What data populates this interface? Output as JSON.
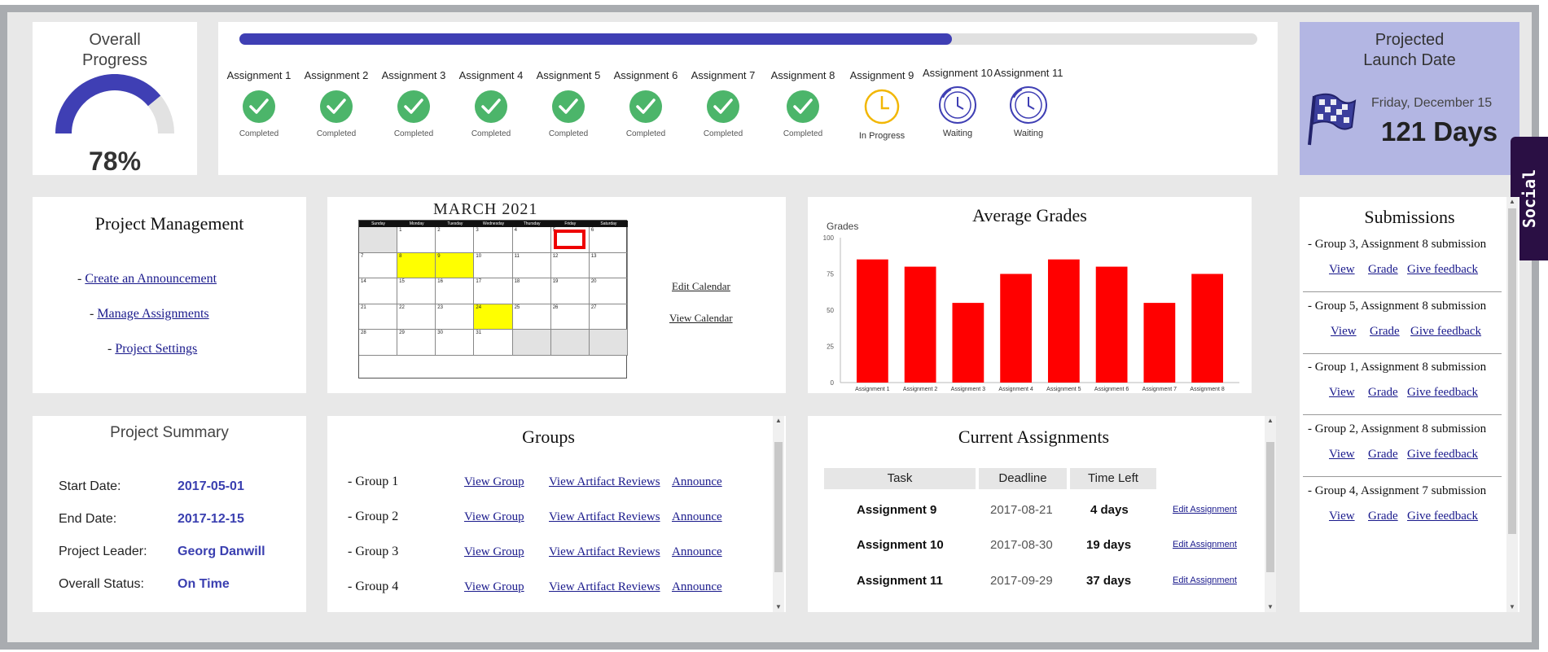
{
  "overall": {
    "title_line1": "Overall",
    "title_line2": "Progress",
    "percent": "78%",
    "progress_fraction": 0.78
  },
  "timeline": {
    "progress_fraction": 0.7,
    "assignments": [
      {
        "name": "Assignment 1",
        "status": "Completed"
      },
      {
        "name": "Assignment 2",
        "status": "Completed"
      },
      {
        "name": "Assignment 3",
        "status": "Completed"
      },
      {
        "name": "Assignment 4",
        "status": "Completed"
      },
      {
        "name": "Assignment 5",
        "status": "Completed"
      },
      {
        "name": "Assignment 6",
        "status": "Completed"
      },
      {
        "name": "Assignment 7",
        "status": "Completed"
      },
      {
        "name": "Assignment 8",
        "status": "Completed"
      },
      {
        "name": "Assignment 9",
        "status": "In Progress"
      },
      {
        "name": "Assignment 10",
        "status": "Waiting"
      },
      {
        "name": "Assignment 11",
        "status": "Waiting"
      }
    ]
  },
  "launch": {
    "title_line1": "Projected",
    "title_line2": "Launch Date",
    "date": "Friday, December 15",
    "days": "121 Days",
    "icon": "checkered-flag-icon"
  },
  "social": {
    "label": "Social"
  },
  "project_management": {
    "title": "Project Management",
    "links": [
      "Create an Announcement",
      "Manage Assignments",
      "Project Settings"
    ]
  },
  "calendar": {
    "title": "MARCH  2021",
    "day_headers": [
      "Sunday",
      "Monday",
      "Tuesday",
      "Wednesday",
      "Thursday",
      "Friday",
      "Saturday"
    ],
    "weeks": [
      [
        "",
        "1",
        "2",
        "3",
        "4",
        "5",
        "6"
      ],
      [
        "7",
        "8",
        "9",
        "10",
        "11",
        "12",
        "13"
      ],
      [
        "14",
        "15",
        "16",
        "17",
        "18",
        "19",
        "20"
      ],
      [
        "21",
        "22",
        "23",
        "24",
        "25",
        "26",
        "27"
      ],
      [
        "28",
        "29",
        "30",
        "31",
        "",
        "",
        ""
      ]
    ],
    "edit_link": "Edit Calendar",
    "view_link": "View Calendar"
  },
  "chart_data": {
    "type": "bar",
    "title": "Average Grades",
    "ylabel": "Grades",
    "xlabel": "",
    "ylim": [
      0,
      100
    ],
    "yticks": [
      0,
      25,
      50,
      75,
      100
    ],
    "categories": [
      "Assignment 1",
      "Assignment 2",
      "Assignment 3",
      "Assignment 4",
      "Assignment 5",
      "Assignment 6",
      "Assignment 7",
      "Assignment 8"
    ],
    "values": [
      85,
      80,
      55,
      75,
      85,
      80,
      55,
      75
    ],
    "color": "#ff0000",
    "grid": false
  },
  "submissions": {
    "title": "Submissions",
    "items": [
      {
        "heading": "- Group 3, Assignment 8 submission"
      },
      {
        "heading": "- Group 5, Assignment 8 submission"
      },
      {
        "heading": "- Group 1, Assignment 8 submission"
      },
      {
        "heading": "- Group 2, Assignment 8 submission"
      },
      {
        "heading": "- Group 4, Assignment 7 submission"
      }
    ],
    "actions": [
      "View",
      "Grade",
      "Give feedback"
    ]
  },
  "summary": {
    "title": "Project Summary",
    "rows": [
      {
        "label": "Start Date:",
        "value": "2017-05-01"
      },
      {
        "label": "End Date:",
        "value": "2017-12-15"
      },
      {
        "label": "Project Leader:",
        "value": "Georg Danwill"
      },
      {
        "label": "Overall Status:",
        "value": "On Time"
      }
    ]
  },
  "groups": {
    "title": "Groups",
    "items": [
      "- Group 1",
      "- Group 2",
      "- Group 3",
      "- Group 4"
    ],
    "actions": [
      "View Group",
      "View Artifact Reviews",
      "Announce"
    ]
  },
  "current": {
    "title": "Current Assignments",
    "headers": [
      "Task",
      "Deadline",
      "Time Left"
    ],
    "rows": [
      {
        "task": "Assignment 9",
        "deadline": "2017-08-21",
        "left": "4 days",
        "action": "Edit Assignment"
      },
      {
        "task": "Assignment 10",
        "deadline": "2017-08-30",
        "left": "19 days",
        "action": "Edit Assignment"
      },
      {
        "task": "Assignment 11",
        "deadline": "2017-09-29",
        "left": "37 days",
        "action": "Edit Assignment"
      }
    ]
  },
  "colors": {
    "accent": "#3f3fb4",
    "complete": "#4cb56a",
    "in_progress": "#f2b705",
    "waiting": "#3f3fb4",
    "launch_bg": "#b3b6e3"
  }
}
